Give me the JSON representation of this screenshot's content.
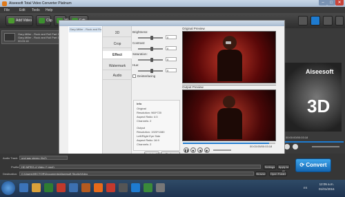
{
  "window": {
    "title": "Aiseesoft Total Video Converter Platinum"
  },
  "menu": [
    "File",
    "Edit",
    "Tools",
    "Help"
  ],
  "toolbar": {
    "add_video": "Add Video",
    "clip": "Clip",
    "3d": "3D",
    "edit": "Edit"
  },
  "file_item": {
    "name": "Gary-Miller - Rock and Roll Part 1",
    "subname": "Gary-Miller - Rock and Roll Part 1",
    "duration": "00:03:18"
  },
  "edit_dialog": {
    "file_list_item": "Gary-Miller - Rock and Roll Part 1",
    "tabs": [
      "3D",
      "Crop",
      "Effect",
      "Watermark",
      "Audio"
    ],
    "active_tab": "Effect",
    "brightness": {
      "label": "Brightness:",
      "value": "0",
      "level": 0.5
    },
    "contrast": {
      "label": "Contrast:",
      "value": "0",
      "level": 0.5
    },
    "saturation": {
      "label": "Saturation:",
      "value": "0",
      "level": 0.5
    },
    "hue": {
      "label": "Hue:",
      "value": "0",
      "level": 0.5
    },
    "deinterlacing": "Deinterlacing",
    "info": {
      "header": "Info",
      "original_header": "Original",
      "original_resolution": "Resolution: 960*720",
      "original_aspect": "Aspect Ratio: 4:3",
      "original_channels": "Channels: 2",
      "output_header": "Output",
      "output_resolution": "Resolution: 1920*1080",
      "output_mode": "Left/Right Eye Side",
      "output_aspect": "Aspect Ratio: 16:9",
      "output_channels": "Channels: 2"
    },
    "apply_all": "Apply to All",
    "restore_defaults": "Restore Defaults",
    "original_preview_label": "Original Preview",
    "output_preview_label": "Output Preview",
    "time": "00:03:05/00:03:18",
    "progress": 0.93,
    "restore_all": "Restore All",
    "apply": "Apply",
    "close": "Close"
  },
  "right_pane": {
    "brand": "Aiseesoft",
    "time": "00:00:00/00:03:18"
  },
  "bottom": {
    "audio_track_label": "Audio Track:",
    "audio_track_value": "und aac stereo (0x2)",
    "profile_label": "Profile:",
    "profile_value": "HD MPEG-4 Video (*.mp4)",
    "settings_button": "Settings",
    "apply_all_button": "Apply to All",
    "destination_label": "Destination:",
    "destination_value": "C:\\Users\\HECTOR\\Documents\\Aiseesoft Studio\\Video",
    "browse_button": "Browse",
    "open_folder_button": "Open Folder",
    "convert_button": "Convert"
  },
  "taskbar": {
    "time": "12:05 a.m.",
    "date": "01/01/2016",
    "lang": "ES"
  },
  "colors": {
    "accent_blue": "#1e7bd0",
    "stage_red": "#7a1010"
  }
}
